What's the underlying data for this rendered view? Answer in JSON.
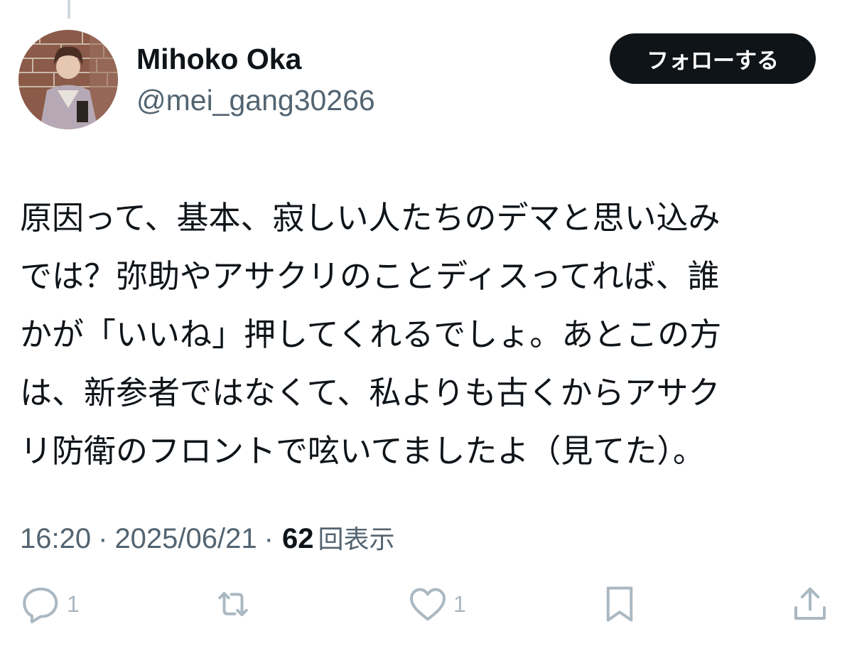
{
  "user": {
    "display_name": "Mihoko Oka",
    "handle": "@mei_gang30266",
    "avatar_icon": "profile-photo"
  },
  "follow_button_label": "フォローする",
  "tweet": {
    "lines": [
      "原因って、基本、寂しい人たちのデマと思い込み",
      "では？弥助やアサクリのことディスってれば、誰",
      "かが「いいね」押してくれるでしょ。あとこの方",
      "は、新参者ではなくて、私よりも古くからアサク",
      "リ防衛のフロントで呟いてましたよ（見てた）。"
    ]
  },
  "meta": {
    "time": "16:20",
    "separator": "·",
    "date": "2025/06/21",
    "views_count": "62",
    "views_label": "回表示"
  },
  "actions": {
    "reply": {
      "icon": "reply-icon",
      "count": "1"
    },
    "retweet": {
      "icon": "retweet-icon"
    },
    "like": {
      "icon": "heart-icon",
      "count": "1"
    },
    "bookmark": {
      "icon": "bookmark-icon"
    },
    "share": {
      "icon": "share-icon"
    }
  },
  "colors": {
    "text": "#0f1419",
    "secondary": "#536471",
    "icon": "#aab8c2",
    "button_bg": "#0f1419"
  }
}
